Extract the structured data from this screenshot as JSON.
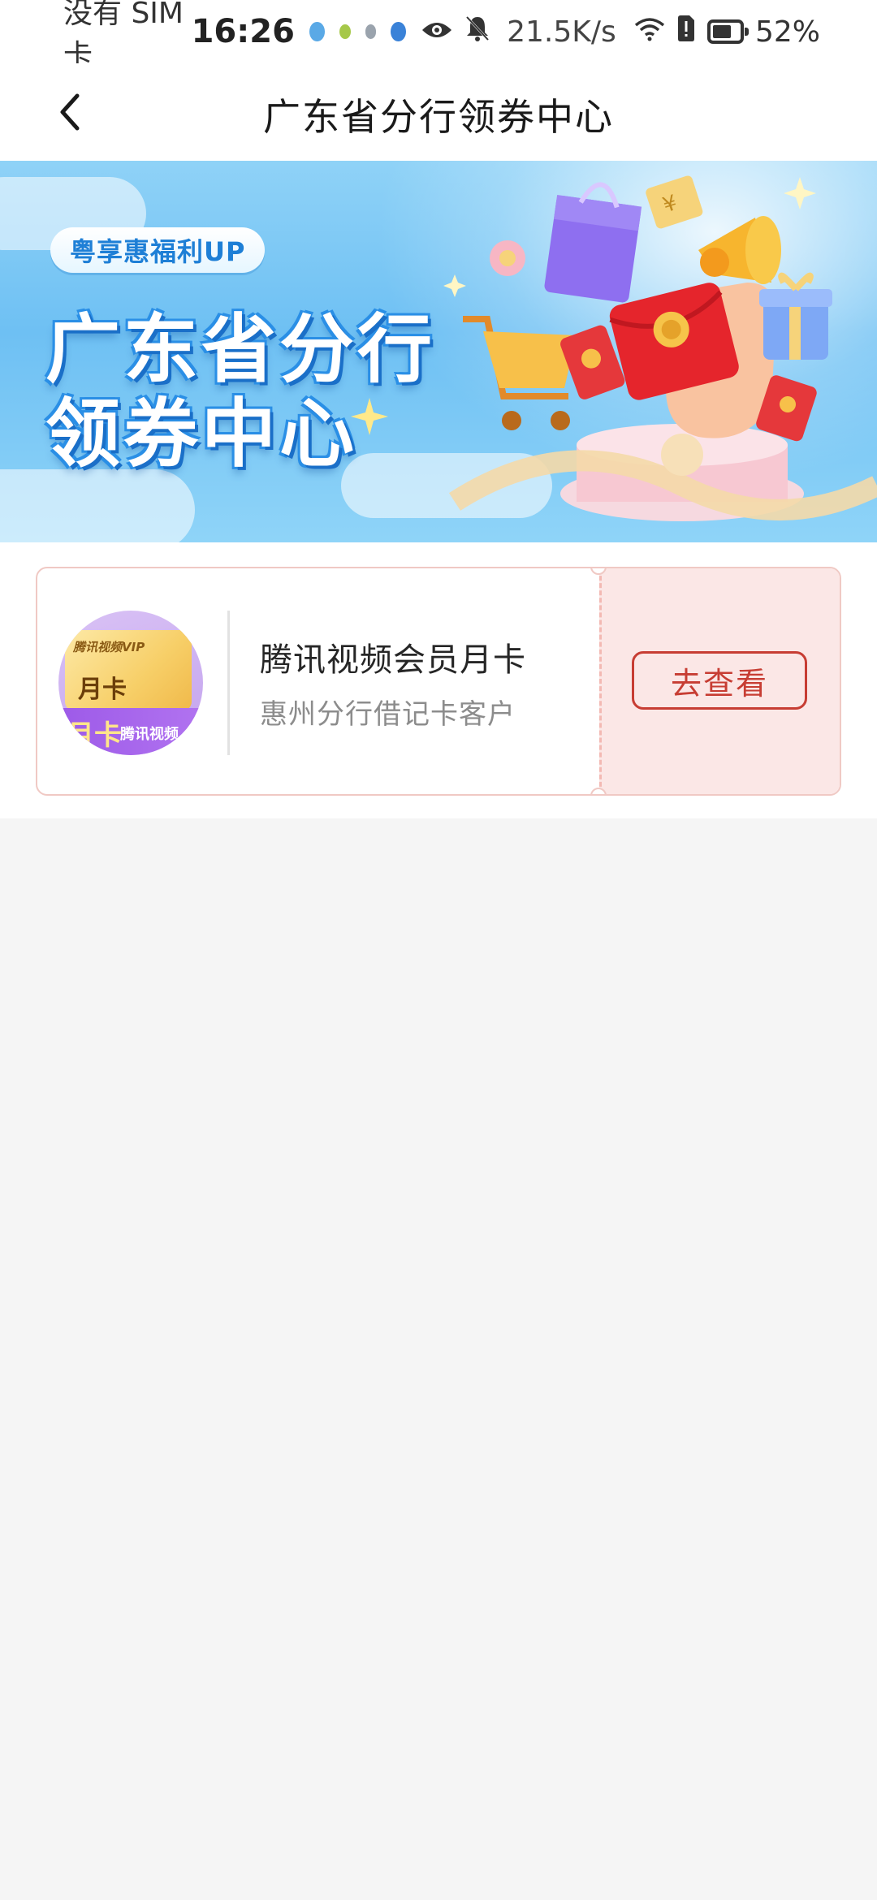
{
  "status_bar": {
    "sim": "没有 SIM 卡",
    "time": "16:26",
    "net_speed": "21.5K/s",
    "battery_percent": "52%",
    "battery_level": 0.52
  },
  "nav": {
    "title": "广东省分行领券中心"
  },
  "banner": {
    "tag": "粤享惠福利UP",
    "headline_line1": "广东省分行",
    "headline_line2": "领券中心"
  },
  "coupons": [
    {
      "thumb_brand": "腾讯视频VIP",
      "thumb_card": "月卡",
      "thumb_strip_big": "月卡",
      "thumb_strip_text": "腾讯视频",
      "name": "腾讯视频会员月卡",
      "subtitle": "惠州分行借记卡客户",
      "action_label": "去查看"
    }
  ],
  "colors": {
    "accent_red": "#c73d33",
    "stub_bg": "#fbe7e6",
    "banner_blue": "#6ec0f3"
  }
}
